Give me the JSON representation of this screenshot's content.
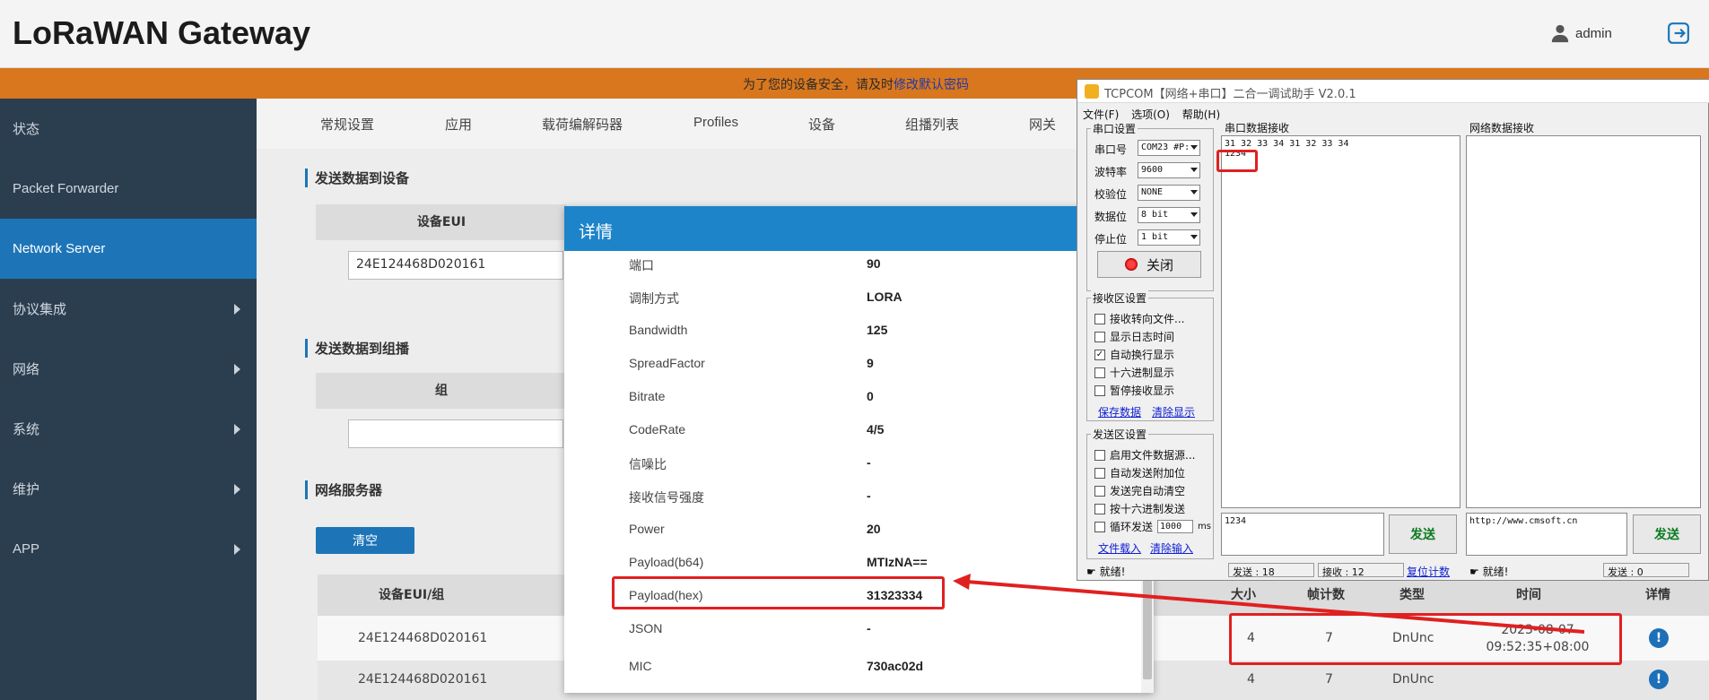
{
  "header": {
    "title": "LoRaWAN Gateway",
    "user": "admin",
    "user_icon": "user-icon",
    "logout_icon": "logout-icon"
  },
  "warning": {
    "text": "为了您的设备安全，请及时",
    "link": "修改默认密码"
  },
  "sidebar": {
    "items": [
      {
        "label": "状态",
        "chev": false
      },
      {
        "label": "Packet Forwarder",
        "chev": false
      },
      {
        "label": "Network Server",
        "chev": false,
        "active": true
      },
      {
        "label": "协议集成",
        "chev": true
      },
      {
        "label": "网络",
        "chev": true
      },
      {
        "label": "系统",
        "chev": true
      },
      {
        "label": "维护",
        "chev": true
      },
      {
        "label": "APP",
        "chev": true
      }
    ]
  },
  "tabs": [
    "常规设置",
    "应用",
    "载荷编解码器",
    "Profiles",
    "设备",
    "组播列表",
    "网关"
  ],
  "sections": {
    "send_device": {
      "title": "发送数据到设备",
      "col_eui": "设备EUI",
      "eui_value": "24E124468D020161"
    },
    "send_group": {
      "title": "发送数据到组播",
      "col_group": "组"
    },
    "ns": {
      "title": "网络服务器",
      "clear": "清空"
    }
  },
  "table": {
    "headers": {
      "eui": "设备EUI/组",
      "size": "大小",
      "frames": "帧计数",
      "type": "类型",
      "time": "时间",
      "detail": "详情"
    },
    "rows": [
      {
        "eui": "24E124468D020161",
        "size": "4",
        "frames": "7",
        "type": "DnUnc",
        "time": "2023-08-07",
        "time2": "09:52:35+08:00"
      },
      {
        "eui": "24E124468D020161",
        "size": "4",
        "frames": "7",
        "type": "DnUnc",
        "time": "",
        "time2": ""
      }
    ]
  },
  "modal": {
    "title": "详情",
    "rows": [
      {
        "k": "端口",
        "v": "90"
      },
      {
        "k": "调制方式",
        "v": "LORA"
      },
      {
        "k": "Bandwidth",
        "v": "125"
      },
      {
        "k": "SpreadFactor",
        "v": "9"
      },
      {
        "k": "Bitrate",
        "v": "0"
      },
      {
        "k": "CodeRate",
        "v": "4/5"
      },
      {
        "k": "信噪比",
        "v": "-"
      },
      {
        "k": "接收信号强度",
        "v": "-"
      },
      {
        "k": "Power",
        "v": "20"
      },
      {
        "k": "Payload(b64)",
        "v": "MTIzNA=="
      },
      {
        "k": "Payload(hex)",
        "v": "31323334"
      },
      {
        "k": "JSON",
        "v": "-"
      },
      {
        "k": "MIC",
        "v": "730ac02d"
      }
    ]
  },
  "tcp": {
    "title": "TCPCOM【网络+串口】二合一调试助手 V2.0.1",
    "menu": [
      "文件(F)",
      "选项(O)",
      "帮助(H)"
    ],
    "serial_group": "串口设置",
    "fields": [
      {
        "label": "串口号",
        "value": "COM23 #P:"
      },
      {
        "label": "波特率",
        "value": "9600"
      },
      {
        "label": "校验位",
        "value": "NONE"
      },
      {
        "label": "数据位",
        "value": "8 bit"
      },
      {
        "label": "停止位",
        "value": "1 bit"
      }
    ],
    "close_label": "关闭",
    "recv_group": "接收区设置",
    "recv_opts": [
      {
        "label": "接收转向文件...",
        "checked": false
      },
      {
        "label": "显示日志时间",
        "checked": false
      },
      {
        "label": "自动换行显示",
        "checked": true
      },
      {
        "label": "十六进制显示",
        "checked": false
      },
      {
        "label": "暂停接收显示",
        "checked": false
      }
    ],
    "save_data": "保存数据",
    "clear_display": "清除显示",
    "send_group": "发送区设置",
    "send_opts": [
      {
        "label": "启用文件数据源...",
        "checked": false
      },
      {
        "label": "自动发送附加位",
        "checked": false
      },
      {
        "label": "发送完自动清空",
        "checked": false
      },
      {
        "label": "按十六进制发送",
        "checked": false
      },
      {
        "label": "循环发送",
        "checked": false
      }
    ],
    "cycle_value": "1000",
    "cycle_unit": "ms",
    "load_file": "文件载入",
    "clear_input": "清除输入",
    "serial_recv_title": "串口数据接收",
    "serial_recv_line1": "31 32 33 34 31 32 33 34",
    "serial_recv_line2": "1234",
    "net_recv_title": "网络数据接收",
    "serial_send_text": "1234",
    "net_send_text": "http://www.cmsoft.cn",
    "send_label": "发送",
    "status_ready": "就绪!",
    "sent_label": "发送 : 18",
    "recv_label": "接收 : 12",
    "reset_label": "复位计数",
    "status_ready2": "就绪!",
    "sent2_label": "发送 : 0"
  }
}
